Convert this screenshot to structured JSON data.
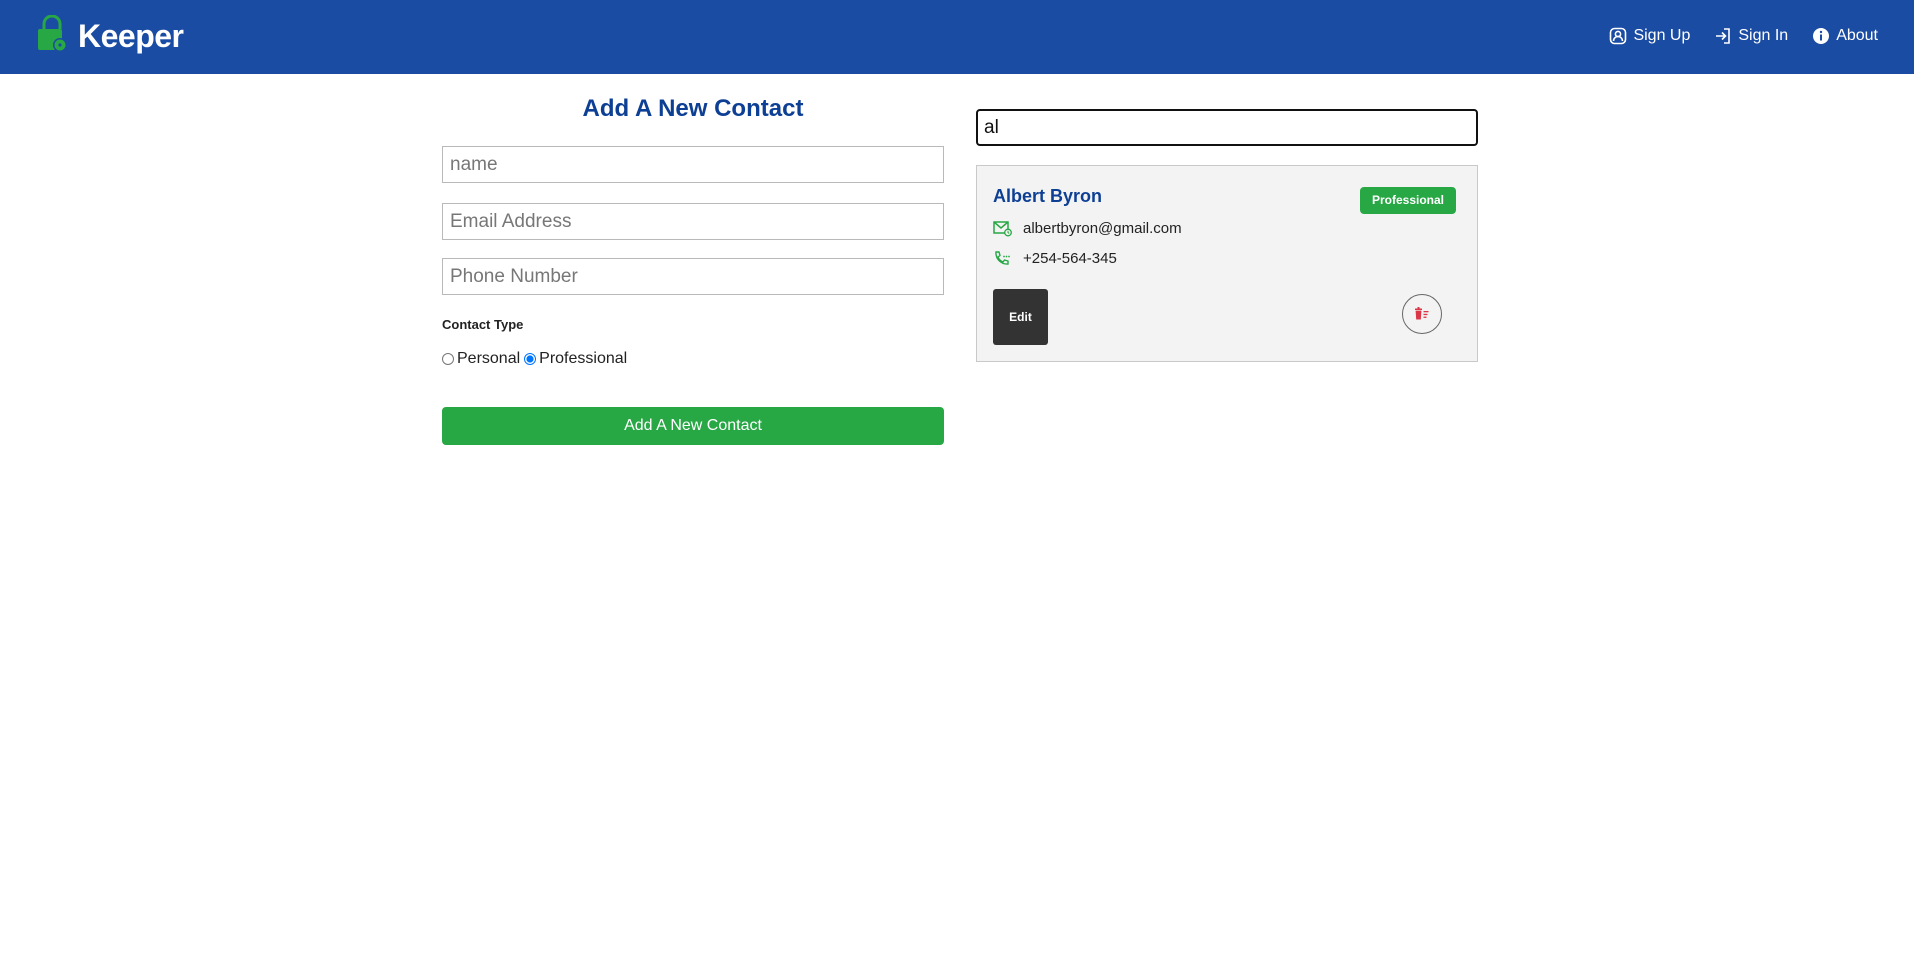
{
  "navbar": {
    "brand": "Keeper",
    "links": [
      {
        "label": "Sign Up",
        "icon": "user-plus-icon"
      },
      {
        "label": "Sign In",
        "icon": "sign-in-icon"
      },
      {
        "label": "About",
        "icon": "info-icon"
      }
    ],
    "background": "#1b4ca3"
  },
  "form": {
    "title": "Add A New Contact",
    "name_placeholder": "name",
    "email_placeholder": "Email Address",
    "phone_placeholder": "Phone Number",
    "contact_type_label": "Contact Type",
    "options": [
      {
        "label": "Personal",
        "selected": false
      },
      {
        "label": "Professional",
        "selected": true
      }
    ],
    "submit_label": "Add A New Contact"
  },
  "search": {
    "value": "al"
  },
  "contacts": [
    {
      "name": "Albert Byron",
      "type": "Professional",
      "email": "albertbyron@gmail.com",
      "phone": "+254-564-345",
      "edit_label": "Edit"
    }
  ],
  "colors": {
    "accent_green": "#28a745",
    "title_blue": "#0d3f94",
    "delete_red": "#dc3545"
  }
}
